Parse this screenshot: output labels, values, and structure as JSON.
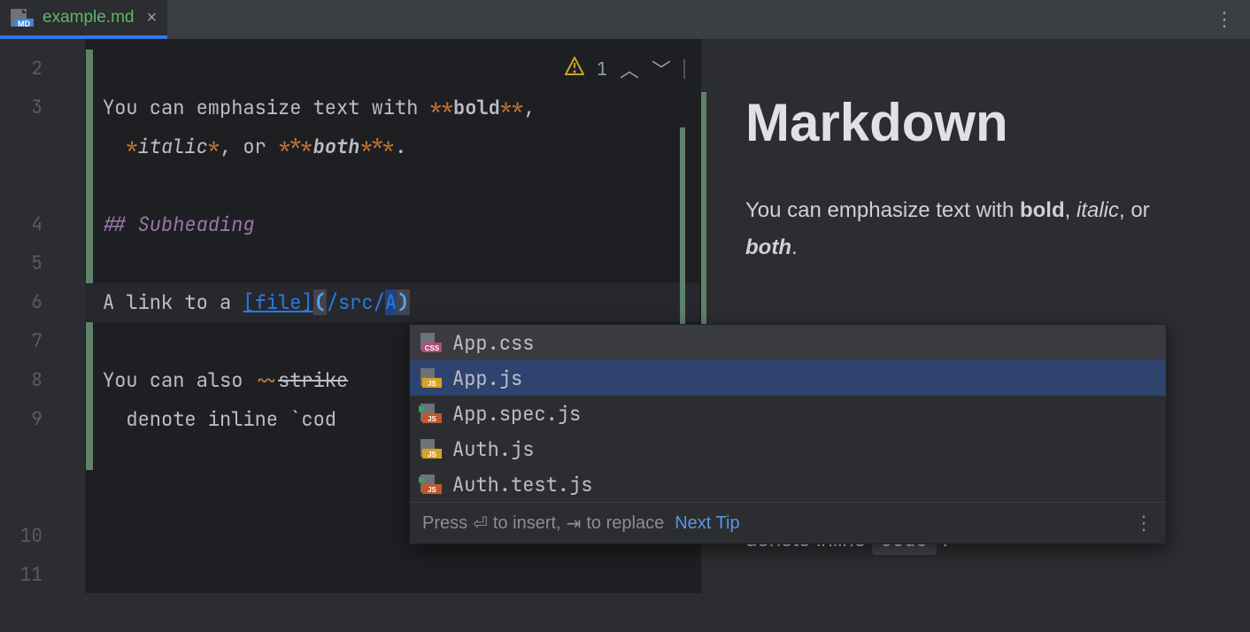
{
  "tab": {
    "filename": "example.md",
    "icon": "markdown-file-icon"
  },
  "editor": {
    "line_numbers": [
      "2",
      "3",
      "4",
      "5",
      "6",
      "7",
      "8",
      "9",
      "10",
      "11"
    ],
    "warning_count": "1",
    "lines": {
      "l2": {},
      "l3": {
        "t1": "You can emphasize text with ",
        "m1": "**",
        "b": "bold",
        "m2": "**",
        "comma": ",",
        "indent": "  ",
        "m3": "*",
        "it": "italic",
        "m4": "*",
        "mid": ", or ",
        "m5": "***",
        "both": "both",
        "m6": "***",
        "dot": "."
      },
      "l5": {
        "heading": "## Subheading"
      },
      "l7": {
        "t1": "A link to a ",
        "lb": "[",
        "ltxt": "file",
        "rb": "]",
        "lp": "(",
        "url": "/src/",
        "typed": "A",
        "rp": ")"
      },
      "l9": {
        "t1": "You can also ",
        "sm1": "~~",
        "strike": "strike",
        "cont": "  denote inline ",
        "tick": "`",
        "code": "cod"
      }
    }
  },
  "popup": {
    "items": [
      {
        "icon": "css",
        "name": "App.css"
      },
      {
        "icon": "js",
        "name": "App.js"
      },
      {
        "icon": "js-run",
        "name": "App.spec.js"
      },
      {
        "icon": "js",
        "name": "Auth.js"
      },
      {
        "icon": "js-run",
        "name": "Auth.test.js"
      }
    ],
    "selected_index": 1,
    "hint_prefix": "Press ",
    "hint_insert": " to insert, ",
    "hint_replace": " to replace",
    "next_tip": "Next Tip"
  },
  "preview": {
    "h1": "Markdown",
    "p1_a": "You can emphasize text with ",
    "p1_bold": "bold",
    "p1_b": ", ",
    "p1_italic": "italic",
    "p1_c": ", or ",
    "p1_both": "both",
    "p1_d": ".",
    "p2_a": "denote inline ",
    "p2_code": "code",
    "p2_b": " ."
  }
}
